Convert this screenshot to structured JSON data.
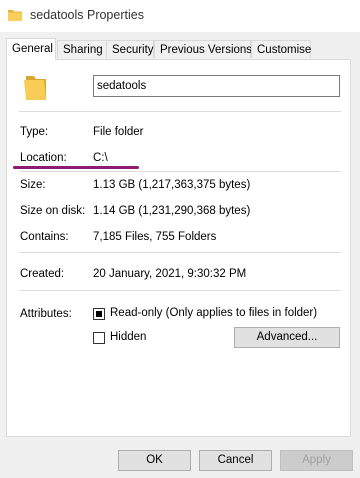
{
  "window": {
    "title": "sedatools Properties"
  },
  "tabs": [
    "General",
    "Sharing",
    "Security",
    "Previous Versions",
    "Customise"
  ],
  "general": {
    "name_value": "sedatools",
    "type_label": "Type:",
    "type_value": "File folder",
    "location_label": "Location:",
    "location_value": "C:\\",
    "size_label": "Size:",
    "size_value": "1.13 GB (1,217,363,375 bytes)",
    "size_on_disk_label": "Size on disk:",
    "size_on_disk_value": "1.14 GB (1,231,290,368 bytes)",
    "contains_label": "Contains:",
    "contains_value": "7,185 Files, 755 Folders",
    "created_label": "Created:",
    "created_value": "20 January, 2021, 9:30:32 PM",
    "attributes_label": "Attributes:",
    "readonly_label": "Read-only (Only applies to files in folder)",
    "readonly_checked": true,
    "hidden_label": "Hidden",
    "hidden_checked": false,
    "advanced_label": "Advanced..."
  },
  "footer": {
    "ok_label": "OK",
    "cancel_label": "Cancel",
    "apply_label": "Apply"
  },
  "colors": {
    "folder": "#f5c84c",
    "annotation": "#8e1a73"
  }
}
